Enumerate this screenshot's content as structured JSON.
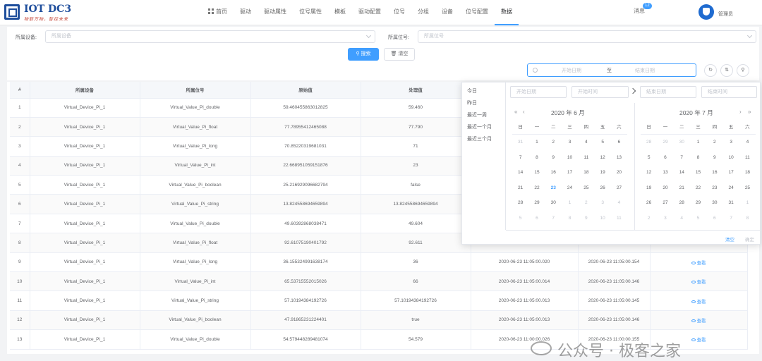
{
  "brand": {
    "title": "IOT DC3",
    "slogan": "物联万物，智控未来"
  },
  "nav": {
    "items": [
      "首页",
      "驱动",
      "驱动属性",
      "位号属性",
      "模板",
      "驱动配置",
      "位号",
      "分组",
      "设备",
      "位号配置",
      "数据"
    ],
    "active_index": 10
  },
  "header": {
    "message_label": "消息",
    "message_count": "12",
    "user_name": "管理员"
  },
  "filter": {
    "device_label": "所属设备:",
    "device_placeholder": "所属设备",
    "point_label": "所属位号:",
    "point_placeholder": "所属位号",
    "search_label": "搜索",
    "clear_label": "清空",
    "range_start_placeholder": "开始日期",
    "range_separator": "至",
    "range_end_placeholder": "结束日期"
  },
  "table": {
    "headers": [
      "#",
      "所属设备",
      "所属位号",
      "原始值",
      "处理值",
      "",
      "",
      ""
    ],
    "view_label": "查看",
    "rows": [
      [
        "1",
        "Virtual_Device_Pi_1",
        "Virtual_Value_Pi_double",
        "59.460455863012825",
        "59.460",
        "",
        "",
        ""
      ],
      [
        "2",
        "Virtual_Device_Pi_1",
        "Virtual_Value_Pi_float",
        "77.78955412465088",
        "77.790",
        "",
        "",
        ""
      ],
      [
        "3",
        "Virtual_Device_Pi_1",
        "Virtual_Value_Pi_long",
        "70.85220319681031",
        "71",
        "",
        "",
        ""
      ],
      [
        "4",
        "Virtual_Device_Pi_1",
        "Virtual_Value_Pi_int",
        "22.668951059151876",
        "23",
        "",
        "",
        ""
      ],
      [
        "5",
        "Virtual_Device_Pi_1",
        "Virtual_Value_Pi_boolean",
        "25.216929096682794",
        "false",
        "",
        "",
        ""
      ],
      [
        "6",
        "Virtual_Device_Pi_1",
        "Virtual_Value_Pi_string",
        "13.824558694659894",
        "13.824558694659894",
        "",
        "",
        ""
      ],
      [
        "7",
        "Virtual_Device_Pi_1",
        "Virtual_Value_Pi_double",
        "49.60392868038471",
        "49.604",
        "",
        "",
        ""
      ],
      [
        "8",
        "Virtual_Device_Pi_1",
        "Virtual_Value_Pi_float",
        "92.61075190401792",
        "92.611",
        "",
        "",
        ""
      ],
      [
        "9",
        "Virtual_Device_Pi_1",
        "Virtual_Value_Pi_long",
        "36.155324991638174",
        "36",
        "2020-06-23 11:05:00.020",
        "2020-06-23 11:05:00.154",
        "查看"
      ],
      [
        "10",
        "Virtual_Device_Pi_1",
        "Virtual_Value_Pi_int",
        "65.53715552015026",
        "66",
        "2020-06-23 11:05:00.014",
        "2020-06-23 11:05:00.146",
        "查看"
      ],
      [
        "11",
        "Virtual_Device_Pi_1",
        "Virtual_Value_Pi_string",
        "57.10194384192726",
        "57.10194384192726",
        "2020-06-23 11:05:00.013",
        "2020-06-23 11:05:00.145",
        "查看"
      ],
      [
        "12",
        "Virtual_Device_Pi_1",
        "Virtual_Value_Pi_boolean",
        "47.91865231224401",
        "true",
        "2020-06-23 11:05:00.013",
        "2020-06-23 11:05:00.146",
        "查看"
      ],
      [
        "13",
        "Virtual_Device_Pi_1",
        "Virtual_Value_Pi_double",
        "54.579448289481074",
        "54.579",
        "2020-06-23 11:00:00.026",
        "2020-06-23 11:00:00.155",
        "查看"
      ]
    ]
  },
  "picker": {
    "shortcuts": [
      "今日",
      "昨日",
      "最近一周",
      "最近一个月",
      "最近三个月"
    ],
    "start_date_placeholder": "开始日期",
    "start_time_placeholder": "开始时间",
    "end_date_placeholder": "结束日期",
    "end_time_placeholder": "结束时间",
    "left_title": "2020 年 6 月",
    "right_title": "2020 年 7 月",
    "prev_year": "«",
    "prev_month": "‹",
    "next_month": "›",
    "next_year": "»",
    "weekdays": [
      "日",
      "一",
      "二",
      "三",
      "四",
      "五",
      "六"
    ],
    "left_days": [
      "31",
      "1",
      "2",
      "3",
      "4",
      "5",
      "6",
      "7",
      "8",
      "9",
      "10",
      "11",
      "12",
      "13",
      "14",
      "15",
      "16",
      "17",
      "18",
      "19",
      "20",
      "21",
      "22",
      "23",
      "24",
      "25",
      "26",
      "27",
      "28",
      "29",
      "30",
      "1",
      "2",
      "3",
      "4",
      "5",
      "6",
      "7",
      "8",
      "9",
      "10",
      "11"
    ],
    "left_off": [
      0,
      31,
      32,
      33,
      34,
      35,
      36,
      37,
      38,
      39,
      40,
      41
    ],
    "left_today": 23,
    "right_days": [
      "28",
      "29",
      "30",
      "1",
      "2",
      "3",
      "4",
      "5",
      "6",
      "7",
      "8",
      "9",
      "10",
      "11",
      "12",
      "13",
      "14",
      "15",
      "16",
      "17",
      "18",
      "19",
      "20",
      "21",
      "22",
      "23",
      "24",
      "25",
      "26",
      "27",
      "28",
      "29",
      "30",
      "31",
      "1",
      "2",
      "3",
      "4",
      "5",
      "6",
      "7",
      "8"
    ],
    "right_off": [
      0,
      1,
      2,
      34,
      35,
      36,
      37,
      38,
      39,
      40,
      41
    ],
    "clear_label": "清空",
    "confirm_label": "确定"
  },
  "watermark": "公众号 · 极客之家",
  "colors": {
    "primary": "#409eff",
    "brand": "#1f4e9c"
  }
}
